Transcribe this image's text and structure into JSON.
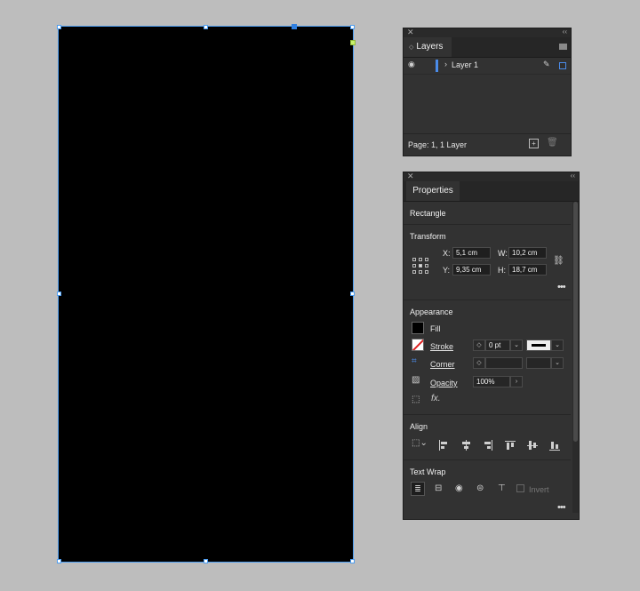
{
  "layers_panel": {
    "tab_label": "Layers",
    "layer_name": "Layer 1",
    "footer_info": "Page: 1, 1 Layer",
    "layer_color": "#4a8be8"
  },
  "properties_panel": {
    "tab_label": "Properties",
    "object_type": "Rectangle",
    "transform": {
      "title": "Transform",
      "x_label": "X:",
      "x_value": "5,1 cm",
      "y_label": "Y:",
      "y_value": "9,35 cm",
      "w_label": "W:",
      "w_value": "10,2 cm",
      "h_label": "H:",
      "h_value": "18,7 cm"
    },
    "appearance": {
      "title": "Appearance",
      "fill_label": "Fill",
      "stroke_label": "Stroke",
      "stroke_value": "0 pt",
      "corner_label": "Corner",
      "opacity_label": "Opacity",
      "opacity_value": "100%"
    },
    "align": {
      "title": "Align"
    },
    "text_wrap": {
      "title": "Text Wrap",
      "invert_label": "Invert"
    }
  },
  "colors": {
    "canvas_bg": "#bdbdbd",
    "artwork_fill": "#000000",
    "selection": "#4d9df0",
    "panel_bg": "#323232"
  }
}
